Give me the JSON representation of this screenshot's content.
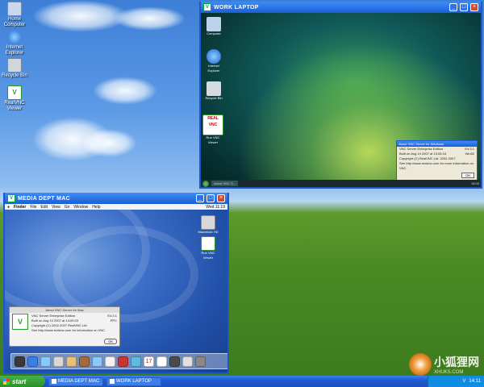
{
  "desktop": {
    "icons": [
      {
        "label": "Home Computer",
        "icon": "computer-icon",
        "color": "#c9d8f0"
      },
      {
        "label": "Internet Explorer",
        "icon": "ie-icon",
        "color": "#3a7ee8"
      },
      {
        "label": "Recycle Bin",
        "icon": "recycle-bin-icon",
        "color": "#cfd6de"
      },
      {
        "label": "RealVNC Viewer",
        "icon": "vnc-viewer-icon",
        "color": "#ffffff"
      }
    ]
  },
  "work_laptop": {
    "title": "WORK LAPTOP",
    "desktop_icons": [
      "Computer",
      "Internet Explorer",
      "Recycle Bin",
      "Run VNC Viewer"
    ],
    "logo_text": "REAL VNC",
    "taskbar_item": "About VNC S...",
    "clock": "18:03",
    "dialog": {
      "title": "About VNC Server for Windows",
      "product": "VNC Server Enterprise Edition",
      "version": "E4.3.1",
      "built": "Built on Aug 14 2007 at 13:05:16",
      "arch": "Win32",
      "copyright": "Copyright (C) RealVNC Ltd. 2002-2007",
      "site": "See http://www.realvnc.com for more information on VNC.",
      "ok": "OK"
    }
  },
  "mac": {
    "title": "MEDIA DEPT MAC",
    "menu": [
      "Finder",
      "File",
      "Edit",
      "View",
      "Go",
      "Window",
      "Help"
    ],
    "clock": "Wed 11:19",
    "desktop_icons": [
      "Macintosh HD",
      "Run VNC Viewer"
    ],
    "dialog": {
      "title": "About VNC Server for Mac",
      "product": "VNC Server Enterprise Edition",
      "version": "E4.3.1",
      "built": "Built on Aug 13 2007 at 14:09:03",
      "arch": "PPC",
      "copyright": "Copyright (C) 2002-2007 RealVNC Ltd.",
      "site": "See http://www.realvnc.com for information on VNC.",
      "ok": "OK"
    },
    "dock_colors": [
      "#3a3a3a",
      "#3a7ee8",
      "#88c8ff",
      "#d8d8d8",
      "#e7c27a",
      "#a36a3a",
      "#8cc8ff",
      "#f2f2f2",
      "#c33",
      "#5dbbe8",
      "#3a8ee8",
      "#ffffff",
      "#4a4a4a",
      "#e0e0e0",
      "#888888"
    ],
    "dock_calendar_day": "17"
  },
  "taskbar": {
    "start": "start",
    "items": [
      "MEDIA DEPT MAC",
      "WORK LAPTOP"
    ],
    "clock": "14:11"
  },
  "watermark": {
    "text": "小狐狸网",
    "sub": "XHUKS.COM"
  }
}
